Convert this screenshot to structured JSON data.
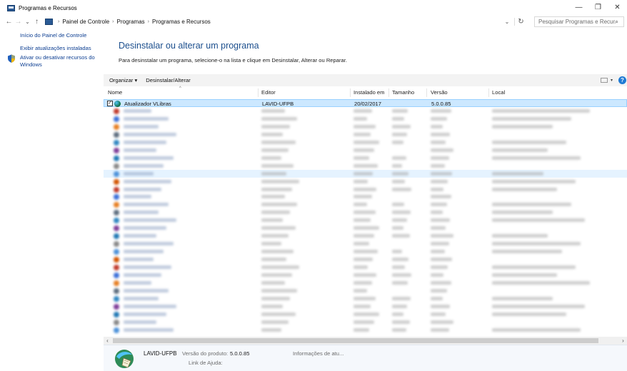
{
  "window": {
    "title": "Programas e Recursos",
    "minimize": "—",
    "maximize": "❐",
    "close": "✕"
  },
  "nav": {
    "back": "←",
    "forward": "→",
    "recent": "⌄",
    "up": "↑",
    "breadcrumbs": [
      "Painel de Controle",
      "Programas",
      "Programas e Recursos"
    ],
    "separator": "›",
    "dropdown": "⌄",
    "refresh": "↻",
    "search_placeholder": "Pesquisar Programas e Recurs...",
    "search_icon": "⌕"
  },
  "sidebar": {
    "items": [
      {
        "label": "Início do Painel de Controle"
      },
      {
        "label": "Exibir atualizações instaladas"
      },
      {
        "label": "Ativar ou desativar recursos do Windows",
        "icon": "shield-icon"
      }
    ]
  },
  "main": {
    "heading": "Desinstalar ou alterar um programa",
    "instructions": "Para desinstalar um programa, selecione-o na lista e clique em Desinstalar, Alterar ou Reparar."
  },
  "toolbar": {
    "organize_label": "Organizar ▾",
    "uninstall_label": "Desinstalar/Alterar",
    "view_dropdown": "▾",
    "help": "?"
  },
  "columns": {
    "name": "Nome",
    "publisher": "Editor",
    "installed_on": "Instalado em",
    "size": "Tamanho",
    "version": "Versão",
    "location": "Local",
    "sort_indicator": "^"
  },
  "programs": {
    "selected": {
      "name": "Atualizador VLibras",
      "publisher": "LAVID-UFPB",
      "installed_on": "20/02/2017",
      "size": "",
      "version": "5.0.0.85",
      "location": "",
      "checked": "✓"
    },
    "blurred_row_count": 29
  },
  "scrollbar": {
    "left": "‹",
    "right": "›"
  },
  "details": {
    "name": "LAVID-UFPB",
    "product_version_label": "Versão do produto:",
    "product_version": "5.0.0.85",
    "support_info_label": "Informações de atu...",
    "help_link_label": "Link de Ajuda:"
  },
  "colors": {
    "link": "#0b3d91",
    "heading": "#1b4e8d",
    "selection": "#cce8ff",
    "selection_border": "#99d1ff"
  }
}
